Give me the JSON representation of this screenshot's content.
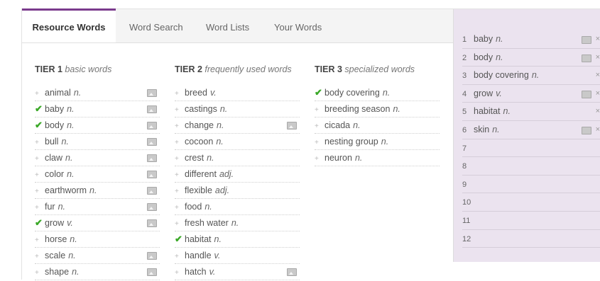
{
  "tabs": [
    {
      "label": "Resource Words",
      "active": true
    },
    {
      "label": "Word Search"
    },
    {
      "label": "Word Lists"
    },
    {
      "label": "Your Words"
    }
  ],
  "tiers": [
    {
      "title": "TIER 1",
      "subtitle": "basic words",
      "words": [
        {
          "word": "animal",
          "pos": "n.",
          "added": false,
          "image": true
        },
        {
          "word": "baby",
          "pos": "n.",
          "added": true,
          "image": true
        },
        {
          "word": "body",
          "pos": "n.",
          "added": true,
          "image": true
        },
        {
          "word": "bull",
          "pos": "n.",
          "added": false,
          "image": true
        },
        {
          "word": "claw",
          "pos": "n.",
          "added": false,
          "image": true
        },
        {
          "word": "color",
          "pos": "n.",
          "added": false,
          "image": true
        },
        {
          "word": "earthworm",
          "pos": "n.",
          "added": false,
          "image": true
        },
        {
          "word": "fur",
          "pos": "n.",
          "added": false,
          "image": true
        },
        {
          "word": "grow",
          "pos": "v.",
          "added": true,
          "image": true
        },
        {
          "word": "horse",
          "pos": "n.",
          "added": false,
          "image": false
        },
        {
          "word": "scale",
          "pos": "n.",
          "added": false,
          "image": true
        },
        {
          "word": "shape",
          "pos": "n.",
          "added": false,
          "image": true
        }
      ]
    },
    {
      "title": "TIER 2",
      "subtitle": "frequently used words",
      "words": [
        {
          "word": "breed",
          "pos": "v.",
          "added": false,
          "image": false
        },
        {
          "word": "castings",
          "pos": "n.",
          "added": false,
          "image": false
        },
        {
          "word": "change",
          "pos": "n.",
          "added": false,
          "image": true
        },
        {
          "word": "cocoon",
          "pos": "n.",
          "added": false,
          "image": false
        },
        {
          "word": "crest",
          "pos": "n.",
          "added": false,
          "image": false
        },
        {
          "word": "different",
          "pos": "adj.",
          "added": false,
          "image": false
        },
        {
          "word": "flexible",
          "pos": "adj.",
          "added": false,
          "image": false
        },
        {
          "word": "food",
          "pos": "n.",
          "added": false,
          "image": false
        },
        {
          "word": "fresh water",
          "pos": "n.",
          "added": false,
          "image": false
        },
        {
          "word": "habitat",
          "pos": "n.",
          "added": true,
          "image": false
        },
        {
          "word": "handle",
          "pos": "v.",
          "added": false,
          "image": false
        },
        {
          "word": "hatch",
          "pos": "v.",
          "added": false,
          "image": true
        }
      ]
    },
    {
      "title": "TIER 3",
      "subtitle": "specialized words",
      "words": [
        {
          "word": "body covering",
          "pos": "n.",
          "added": true,
          "image": false
        },
        {
          "word": "breeding season",
          "pos": "n.",
          "added": false,
          "image": false
        },
        {
          "word": "cicada",
          "pos": "n.",
          "added": false,
          "image": false
        },
        {
          "word": "nesting group",
          "pos": "n.",
          "added": false,
          "image": false
        },
        {
          "word": "neuron",
          "pos": "n.",
          "added": false,
          "image": false
        }
      ]
    }
  ],
  "your_words": [
    {
      "num": "1",
      "word": "baby",
      "pos": "n.",
      "image": true,
      "removable": true
    },
    {
      "num": "2",
      "word": "body",
      "pos": "n.",
      "image": true,
      "removable": true
    },
    {
      "num": "3",
      "word": "body covering",
      "pos": "n.",
      "image": false,
      "removable": true
    },
    {
      "num": "4",
      "word": "grow",
      "pos": "v.",
      "image": true,
      "removable": true
    },
    {
      "num": "5",
      "word": "habitat",
      "pos": "n.",
      "image": false,
      "removable": true
    },
    {
      "num": "6",
      "word": "skin",
      "pos": "n.",
      "image": true,
      "removable": true
    },
    {
      "num": "7",
      "word": "",
      "pos": "",
      "image": false,
      "removable": false
    },
    {
      "num": "8",
      "word": "",
      "pos": "",
      "image": false,
      "removable": false
    },
    {
      "num": "9",
      "word": "",
      "pos": "",
      "image": false,
      "removable": false
    },
    {
      "num": "10",
      "word": "",
      "pos": "",
      "image": false,
      "removable": false
    },
    {
      "num": "11",
      "word": "",
      "pos": "",
      "image": false,
      "removable": false
    },
    {
      "num": "12",
      "word": "",
      "pos": "",
      "image": false,
      "removable": false
    }
  ],
  "symbols": {
    "add": "+",
    "check": "✔",
    "remove": "×"
  },
  "colors": {
    "accent": "#7a3a8c",
    "check": "#3aa827",
    "panel_bg": "#ebe3ef"
  }
}
